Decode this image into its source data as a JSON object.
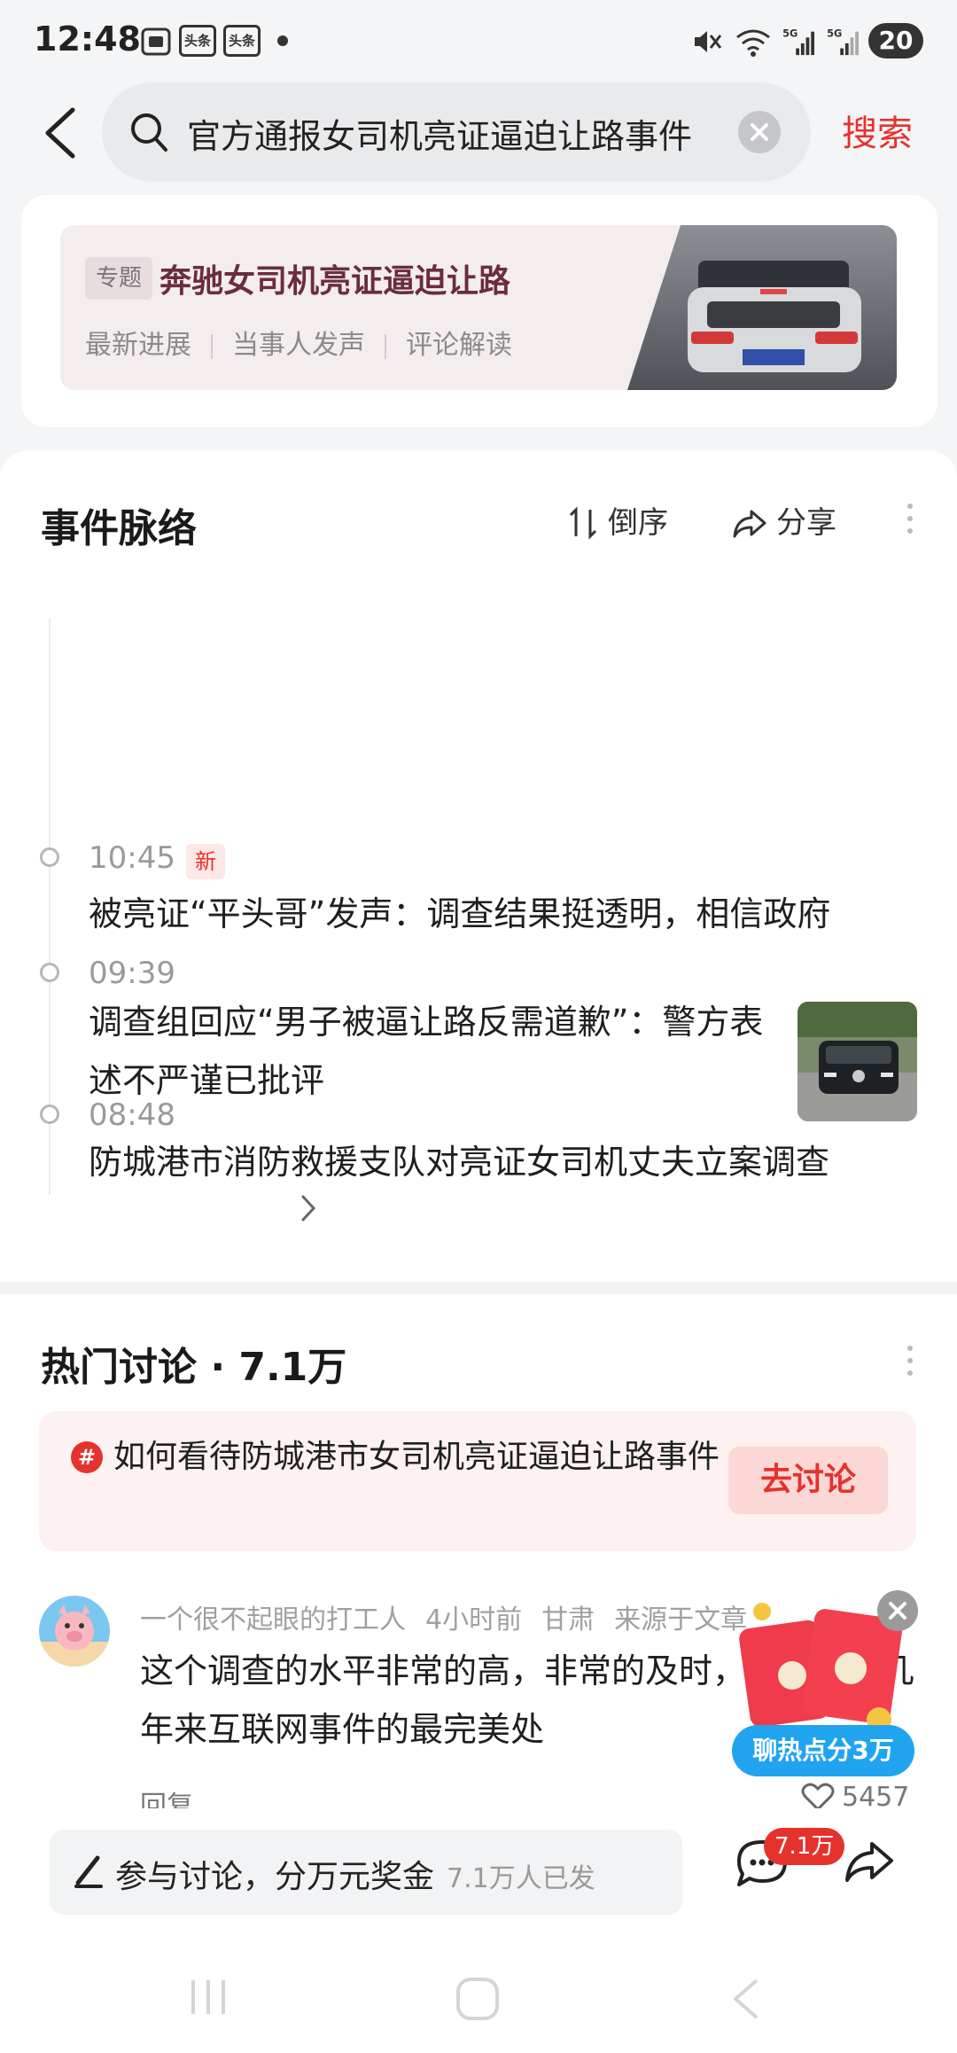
{
  "status_bar": {
    "time": "12:48",
    "badge1": "头条",
    "badge2": "头条",
    "battery": "20",
    "icons": [
      "screenshot-icon",
      "mute-icon",
      "wifi-icon",
      "signal-5g-icon",
      "signal-5g-icon"
    ]
  },
  "search": {
    "query": "官方通报女司机亮证逼迫让路事件",
    "button": "搜索"
  },
  "topic": {
    "tag": "专题",
    "title": "奔驰女司机亮证逼迫让路",
    "links": [
      "最新进展",
      "当事人发声",
      "评论解读"
    ]
  },
  "timeline": {
    "title": "事件脉络",
    "sort_label": "倒序",
    "share_label": "分享",
    "items": [
      {
        "time": "10:45",
        "badge": "新",
        "text": "被亮证“平头哥”发声：调查结果挺透明，相信政府"
      },
      {
        "time": "09:39",
        "text": "调查组回应“男子被逼让路反需道歉”：警方表述不严谨已批评"
      },
      {
        "time": "08:48",
        "text": "防城港市消防救援支队对亮证女司机丈夫立案调查"
      }
    ]
  },
  "discussion": {
    "title": "热门讨论 · 7.1万",
    "question": "如何看待防城港市女司机亮证逼迫让路事件",
    "question_button": "去讨论",
    "comment": {
      "user": "一个很不起眼的打工人",
      "time": "4小时前",
      "location": "甘肃",
      "source": "来源于文章",
      "text": "这个调查的水平非常的高，非常的及时，人说是这几年来互联网事件的最完美处",
      "reply": "回复",
      "likes": "5457"
    }
  },
  "packet": {
    "label": "聊热点分3万"
  },
  "bottom": {
    "input_text": "参与讨论，分万元奖金",
    "input_sub": "7.1万人已发",
    "comment_count": "7.1万"
  },
  "colors": {
    "accent": "#e5322d",
    "topic_title": "#6b2d3b",
    "packet_blue": "#21a4ef"
  }
}
